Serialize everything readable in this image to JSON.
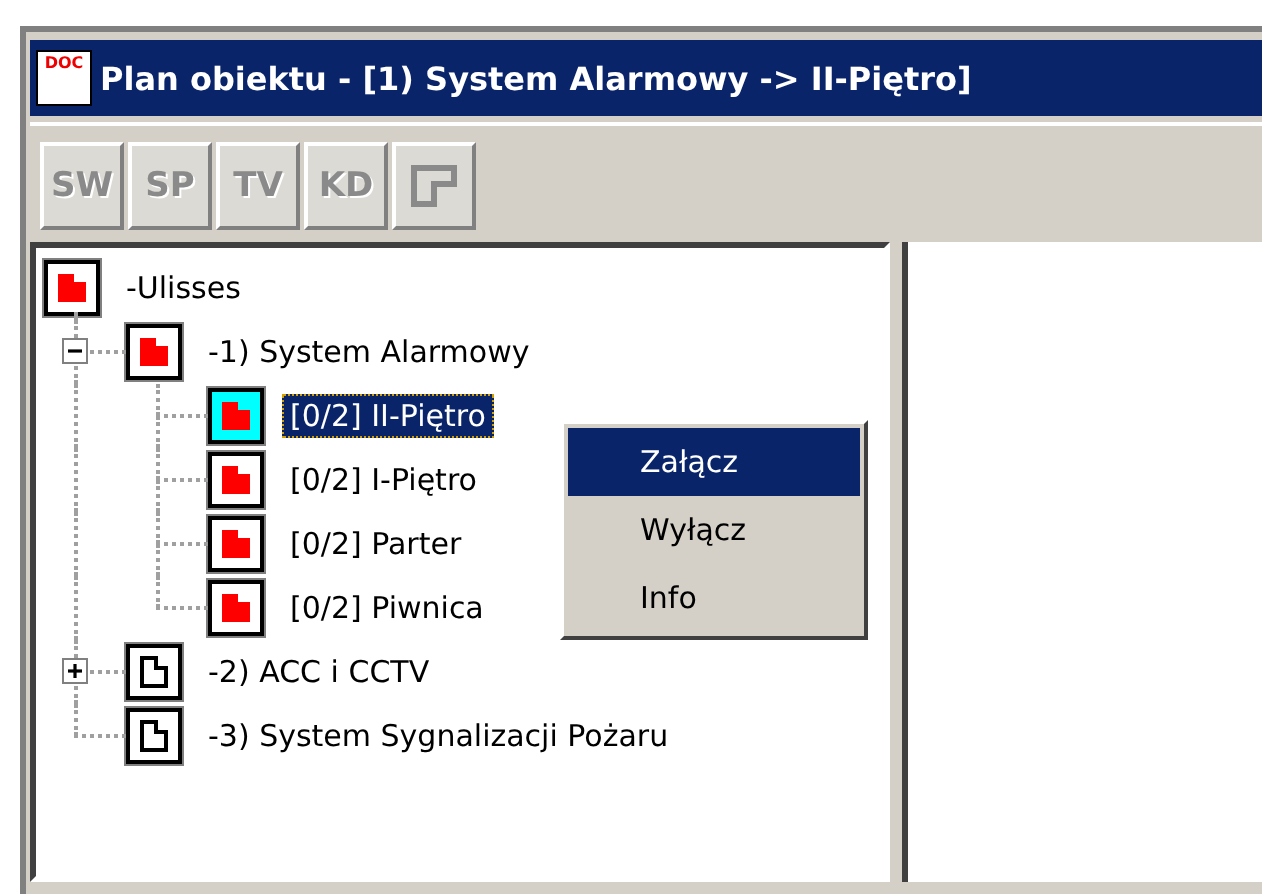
{
  "window": {
    "icon_text": "DOC",
    "title": "Plan obiektu - [1) System Alarmowy -> II-Piętro]"
  },
  "toolbar": [
    {
      "label": "SW",
      "kind": "text",
      "disabled": true
    },
    {
      "label": "SP",
      "kind": "text",
      "disabled": true
    },
    {
      "label": "TV",
      "kind": "text",
      "disabled": true
    },
    {
      "label": "KD",
      "kind": "text",
      "disabled": true
    },
    {
      "kind": "icon",
      "disabled": true
    }
  ],
  "tree": [
    {
      "label": "-Ulisses",
      "alarm": true,
      "selected": false,
      "children": [
        {
          "label": "-1) System Alarmowy",
          "alarm": true,
          "selected": false,
          "expanded": true,
          "children": [
            {
              "label": "[0/2] II-Piętro",
              "alarm": true,
              "selected": true
            },
            {
              "label": "[0/2] I-Piętro",
              "alarm": true,
              "selected": false
            },
            {
              "label": "[0/2] Parter",
              "alarm": true,
              "selected": false
            },
            {
              "label": "[0/2] Piwnica",
              "alarm": true,
              "selected": false
            }
          ]
        },
        {
          "label": "-2) ACC i CCTV",
          "alarm": false,
          "selected": false,
          "expanded": false
        },
        {
          "label": "-3) System Sygnalizacji Pożaru",
          "alarm": false,
          "selected": false
        }
      ]
    }
  ],
  "context_menu": [
    {
      "label": "Załącz",
      "selected": true
    },
    {
      "label": "Wyłącz",
      "selected": false
    },
    {
      "label": "Info",
      "selected": false
    }
  ]
}
